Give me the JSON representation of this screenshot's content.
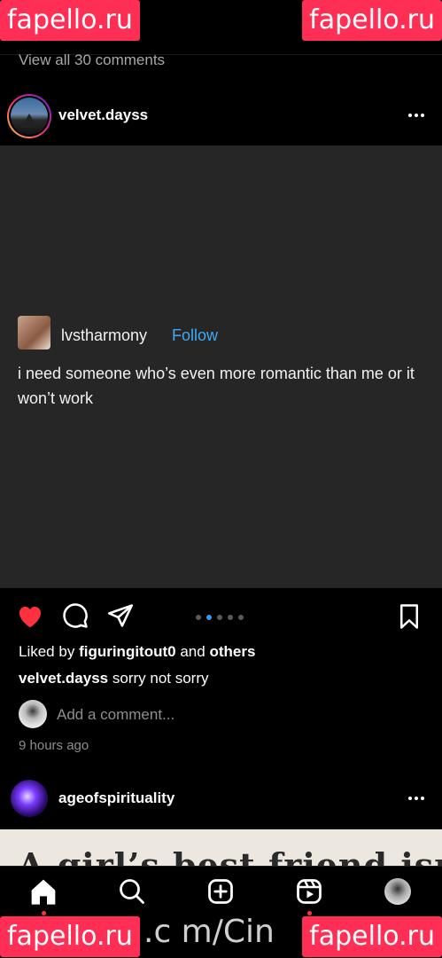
{
  "watermark": {
    "text": "fapello.ru",
    "bottom_text": ".c m/Cin"
  },
  "prev_post": {
    "view_comments": "View all 30 comments"
  },
  "post1": {
    "username": "velvet.dayss",
    "quote": {
      "username": "lvstharmony",
      "follow": "Follow",
      "text": "i need someone who’s even more romantic than me or it won’t work"
    },
    "likes": {
      "prefix": "Liked by",
      "user": "figuringitout0",
      "and": "and",
      "others": "others"
    },
    "caption": {
      "username": "velvet.dayss",
      "text": "sorry not sorry"
    },
    "add_comment_placeholder": "Add a comment...",
    "time": "9 hours ago",
    "carousel": {
      "count": 5,
      "active": 1
    }
  },
  "post2": {
    "username": "ageofspirituality",
    "image_text": "A girl’s best friend isn’t"
  },
  "nav": {
    "icons": [
      "home-icon",
      "search-icon",
      "create-icon",
      "reels-icon",
      "profile-avatar"
    ]
  },
  "colors": {
    "like": "#ff3040",
    "link": "#3797f0",
    "watermark": "#ff2e55"
  }
}
